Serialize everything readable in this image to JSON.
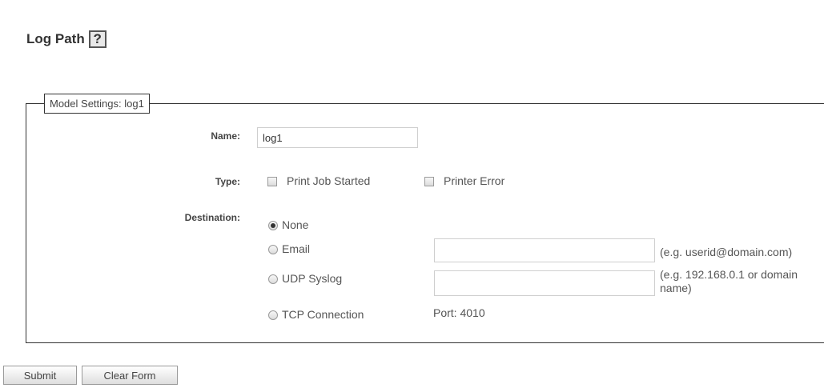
{
  "page": {
    "title": "Log Path",
    "help_icon": "?"
  },
  "settings": {
    "legend": "Model Settings: log1",
    "name_label": "Name:",
    "name_value": "log1",
    "type_label": "Type:",
    "type_options": [
      {
        "label": "Print Job Started",
        "checked": false
      },
      {
        "label": "Printer Error",
        "checked": false
      }
    ],
    "destination_label": "Destination:",
    "destinations": [
      {
        "label": "None",
        "checked": true
      },
      {
        "label": "Email",
        "checked": false,
        "value": "",
        "hint": "(e.g. userid@domain.com)"
      },
      {
        "label": "UDP Syslog",
        "checked": false,
        "value": "",
        "hint": "(e.g. 192.168.0.1 or domain name)"
      },
      {
        "label": "TCP Connection",
        "checked": false,
        "port_text": "Port: 4010"
      }
    ]
  },
  "actions": {
    "submit_label": "Submit",
    "clear_label": "Clear Form"
  }
}
